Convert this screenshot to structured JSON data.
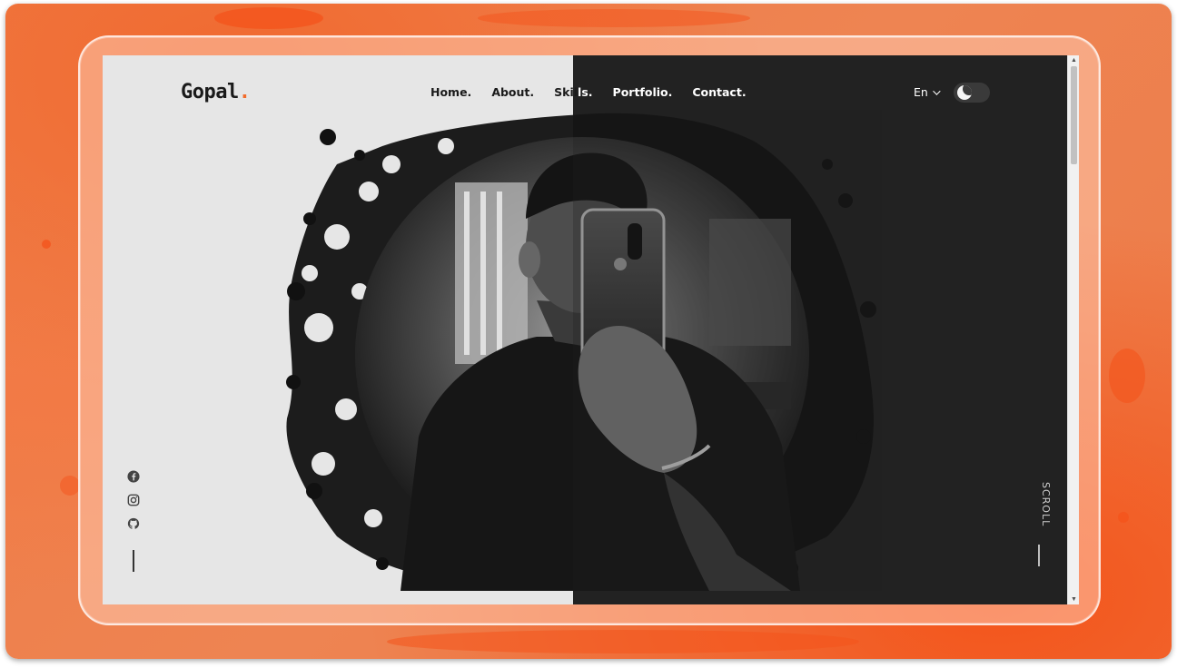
{
  "brand": {
    "name": "Gopal",
    "dot": "."
  },
  "nav": {
    "home": "Home.",
    "about": "About.",
    "skills_a": "Skil",
    "skills_b": "ls.",
    "portfolio": "Portfolio.",
    "contact": "Contact."
  },
  "language": {
    "selected": "En"
  },
  "theme_toggle": {
    "state": "dark",
    "icon": "moon-icon"
  },
  "social": [
    {
      "icon": "facebook-icon"
    },
    {
      "icon": "instagram-icon"
    },
    {
      "icon": "github-icon"
    }
  ],
  "scroll_indicator": {
    "label": "SCROLL"
  },
  "colors": {
    "accent": "#f26c2c",
    "light_bg": "#e6e6e6",
    "dark_bg": "#222222",
    "outer_bg": "#ef7a44"
  }
}
